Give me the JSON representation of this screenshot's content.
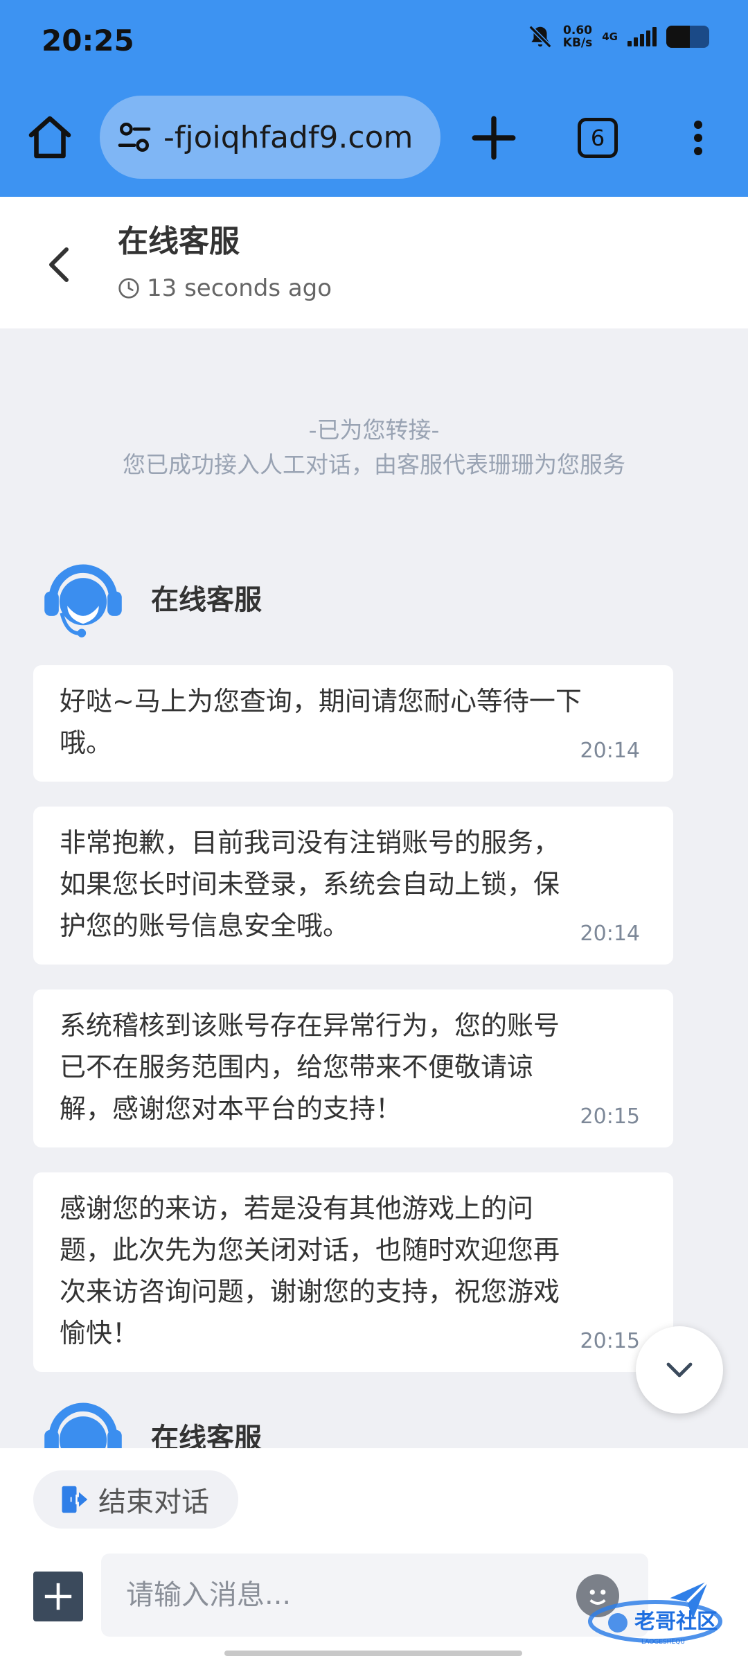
{
  "status_bar": {
    "time": "20:25",
    "net_speed_value": "0.60",
    "net_speed_unit": "KB/s",
    "network_type": "4G",
    "battery_level": 0.55,
    "icons": [
      "bell-off-icon",
      "signal-icon",
      "battery-icon"
    ]
  },
  "browser": {
    "url": "-fjoiqhfadf9.com",
    "tab_count": "6",
    "accent": "#3d93f2",
    "icons": [
      "home-icon",
      "site-settings-icon",
      "plus-icon",
      "more-vert-icon"
    ]
  },
  "header": {
    "title": "在线客服",
    "subtitle": "13 seconds ago",
    "icons": [
      "back-icon",
      "clock-icon"
    ]
  },
  "notice": {
    "line1": "-已为您转接-",
    "line2": "您已成功接入人工对话，由客服代表珊珊为您服务"
  },
  "agent": {
    "name": "在线客服",
    "avatar_icon": "headset-agent-icon",
    "color": "#3b8eef"
  },
  "messages": [
    {
      "text": "好哒~马上为您查询，期间请您耐心等待一下哦。",
      "time": "20:14"
    },
    {
      "text": "非常抱歉，目前我司没有注销账号的服务，如果您长时间未登录，系统会自动上锁，保护您的账号信息安全哦。",
      "time": "20:14"
    },
    {
      "text": "系统稽核到该账号存在异常行为，您的账号已不在服务范围内，给您带来不便敬请谅解，感谢您对本平台的支持！",
      "time": "20:15"
    },
    {
      "text": "感谢您的来访，若是没有其他游戏上的问题，此次先为您关闭对话，也随时欢迎您再次来访咨询问题，谢谢您的支持，祝您游戏愉快！",
      "time": "20:15"
    }
  ],
  "second_agent": {
    "name": "在线客服"
  },
  "footer": {
    "end_chat_label": "结束对话",
    "input_placeholder": "请输入消息...",
    "icons": [
      "exit-icon",
      "plus-icon",
      "emoji-icon",
      "send-icon",
      "chevron-down-icon"
    ]
  },
  "watermark": {
    "text": "老哥社区",
    "subtext": "LAOGESHEQU"
  }
}
